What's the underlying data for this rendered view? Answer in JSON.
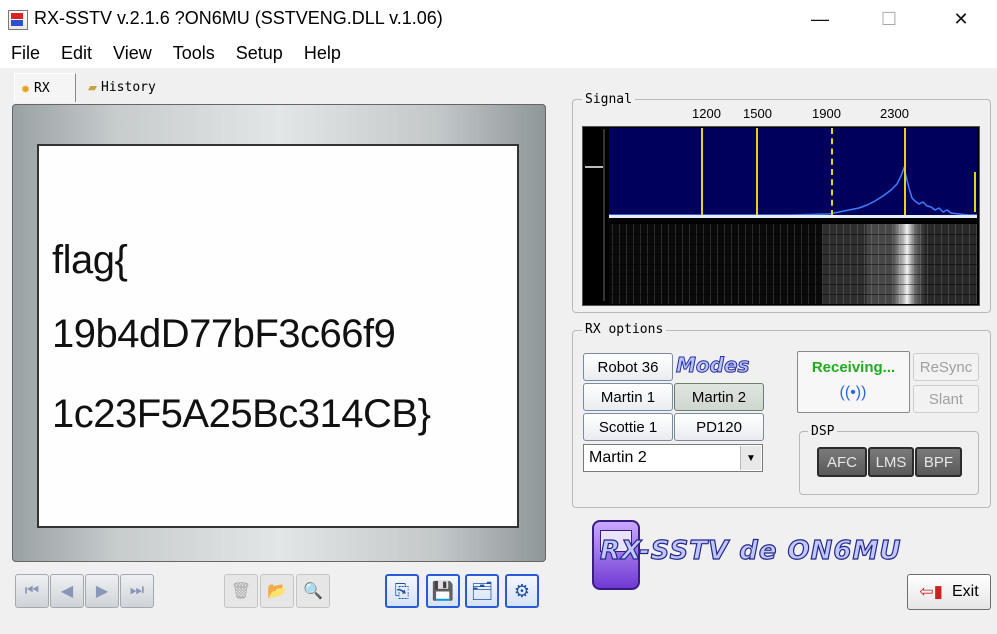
{
  "window": {
    "title": "RX-SSTV v.2.1.6 ?ON6MU (SSTVENG.DLL v.1.06)",
    "minimize_glyph": "—",
    "maximize_glyph": "☐",
    "close_glyph": "✕"
  },
  "menu": [
    "File",
    "Edit",
    "View",
    "Tools",
    "Setup",
    "Help"
  ],
  "tabs": [
    {
      "label": "RX",
      "icon": "gear-icon",
      "glyph": "✹"
    },
    {
      "label": "History",
      "icon": "folder-icon",
      "glyph": "▰"
    }
  ],
  "image": {
    "lines": [
      "flag{",
      "19b4dD77bF3c66f9",
      "1c23F5A25Bc314CB}"
    ]
  },
  "nav_buttons": [
    {
      "name": "first-image-button",
      "glyph": "⏮"
    },
    {
      "name": "previous-image-button",
      "glyph": "◀"
    },
    {
      "name": "next-image-button",
      "glyph": "▶"
    },
    {
      "name": "last-image-button",
      "glyph": "⏭"
    }
  ],
  "tool_buttons": [
    {
      "name": "delete-button",
      "glyph": "🗑"
    },
    {
      "name": "open-folder-button",
      "glyph": "📂"
    },
    {
      "name": "zoom-button",
      "glyph": "🔍"
    }
  ],
  "action_buttons": [
    {
      "name": "copy-button",
      "glyph": "⎘"
    },
    {
      "name": "save-button",
      "glyph": "💾"
    },
    {
      "name": "save-as-button",
      "glyph": "🗂"
    },
    {
      "name": "settings-button",
      "glyph": "⚙"
    }
  ],
  "signal": {
    "title": "Signal",
    "freq_labels": [
      "1200",
      "1500",
      "1900",
      "2300"
    ]
  },
  "rx_options": {
    "title": "RX options",
    "modes_logo": "Modes",
    "mode_buttons": [
      "Robot 36",
      "Martin 1",
      "Martin 2",
      "Scottie 1",
      "PD120"
    ],
    "selected_mode": "Martin 2",
    "dropdown_value": "Martin 2",
    "status": "Receiving...",
    "resync_label": "ReSync",
    "slant_label": "Slant"
  },
  "dsp": {
    "title": "DSP",
    "buttons": [
      "AFC",
      "LMS",
      "BPF"
    ]
  },
  "logo": {
    "text": "RX-SSTV de ON6MU"
  },
  "exit_label": "Exit",
  "colors": {
    "status_green": "#22aa22",
    "spectrum_bg": "#00005c",
    "marker_yellow": "#e4d21c",
    "accent_blue": "#2a5bd7"
  }
}
